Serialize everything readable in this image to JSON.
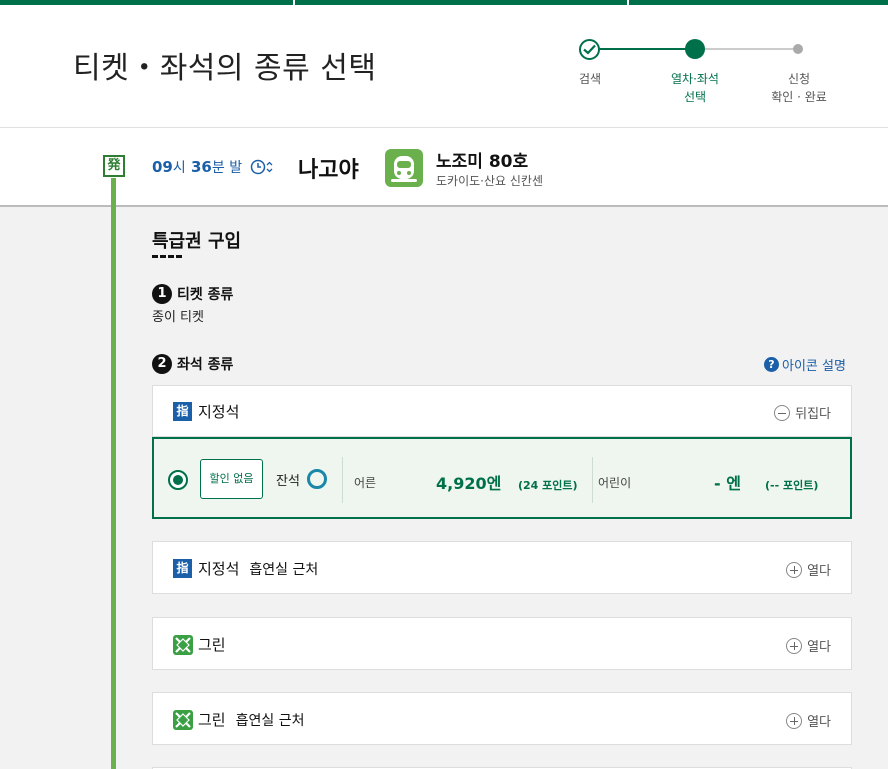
{
  "header": {
    "title": "티켓・좌석의 종류 선택",
    "steps": [
      {
        "label": "검색",
        "state": "done"
      },
      {
        "label_line1": "열차·좌석",
        "label_line2": "선택",
        "state": "current"
      },
      {
        "label_line1": "신청",
        "label_line2": "확인 · 완료",
        "state": "todo"
      }
    ]
  },
  "train": {
    "depart_marker": "発",
    "dep_hour": "09",
    "dep_hour_unit": "시",
    "dep_min": "36",
    "dep_min_unit": "분 발",
    "destination": "나고야",
    "name": "노조미 80호",
    "line": "도카이도·산요 신칸센"
  },
  "purchase": {
    "section_title": "특급권 구입",
    "ticket_type": {
      "num": "1",
      "label": "티켓 종류",
      "value": "종이 티켓"
    },
    "seat_type": {
      "num": "2",
      "label": "좌석 종류",
      "help": "아이콘 설명"
    }
  },
  "cards": {
    "reserved": {
      "badge": "指",
      "label": "지정석",
      "toggle": "뒤집다"
    },
    "option": {
      "discount": "할인 없음",
      "availability_label": "잔석",
      "adult_label": "어른",
      "adult_price": "4,920엔",
      "adult_points": "(24 포인트)",
      "child_label": "어린이",
      "child_price": "- 엔",
      "child_points": "(-- 포인트)"
    },
    "reserved_smoking": {
      "badge": "指",
      "label": "지정석",
      "sub": "흡연실 근처",
      "toggle": "열다"
    },
    "green": {
      "label": "그린",
      "toggle": "열다"
    },
    "green_smoking": {
      "label": "그린",
      "sub": "흡연실 근처",
      "toggle": "열다"
    }
  },
  "colors": {
    "brand_green": "#00704a",
    "timeline_green": "#6ab04c",
    "link_blue": "#1a5fa8"
  }
}
